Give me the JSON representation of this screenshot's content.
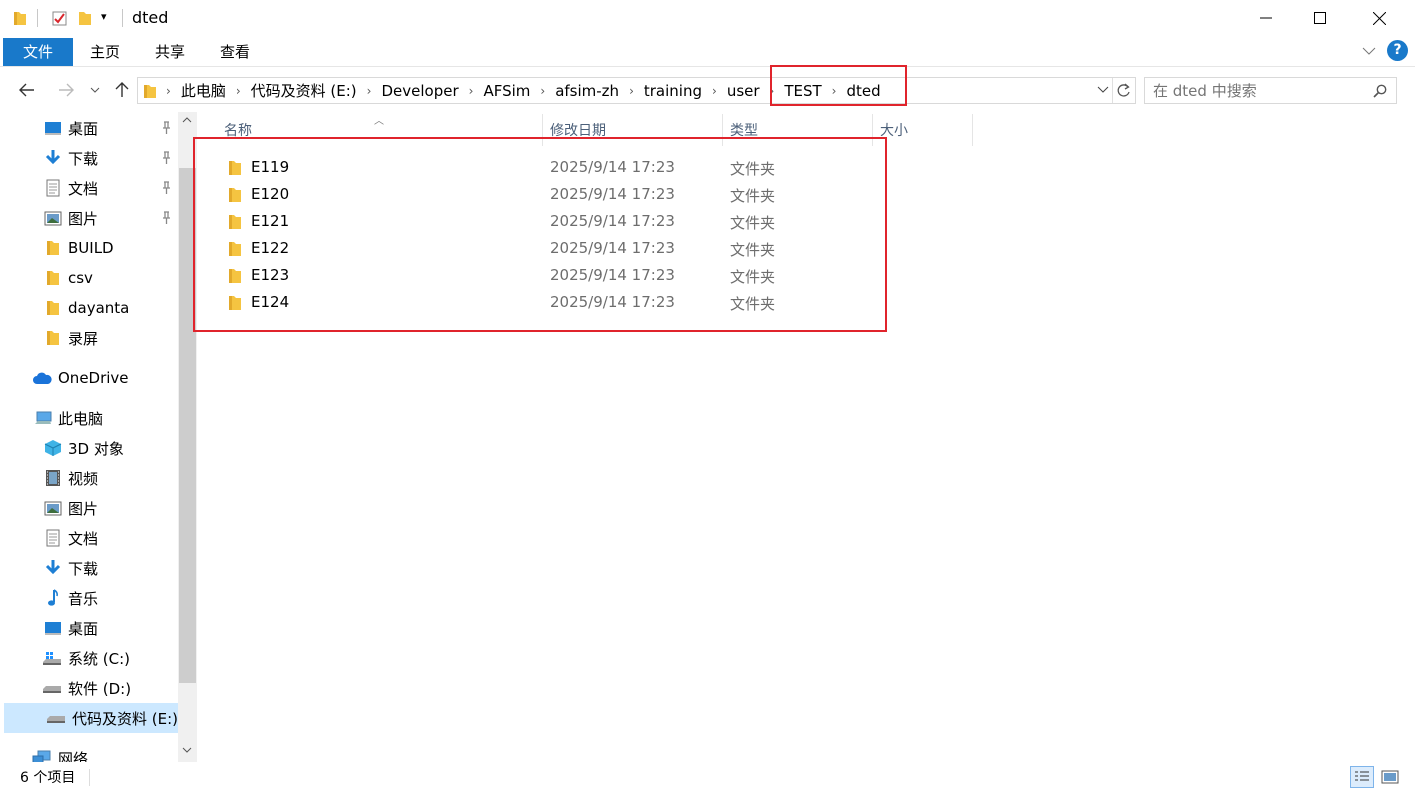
{
  "window": {
    "title": "dted",
    "minimize_glyph": "─",
    "maximize_glyph": "☐",
    "close_glyph": "✕"
  },
  "ribbon": {
    "tabs": [
      "文件",
      "主页",
      "共享",
      "查看"
    ],
    "help_glyph": "?",
    "expand_glyph": "﹀"
  },
  "address": {
    "crumbs": [
      "此电脑",
      "代码及资料 (E:)",
      "Developer",
      "AFSim",
      "afsim-zh",
      "training",
      "user",
      "TEST",
      "dted"
    ],
    "search_placeholder": "在 dted 中搜索"
  },
  "nav": {
    "quick_access": [
      {
        "label": "桌面",
        "icon": "desktop-icon",
        "pinned": true
      },
      {
        "label": "下载",
        "icon": "download-icon",
        "pinned": true
      },
      {
        "label": "文档",
        "icon": "document-icon",
        "pinned": true
      },
      {
        "label": "图片",
        "icon": "picture-icon",
        "pinned": true
      },
      {
        "label": "BUILD",
        "icon": "folder-icon",
        "pinned": false
      },
      {
        "label": "csv",
        "icon": "folder-icon",
        "pinned": false
      },
      {
        "label": "dayanta",
        "icon": "folder-icon",
        "pinned": false
      },
      {
        "label": "录屏",
        "icon": "folder-icon",
        "pinned": false
      }
    ],
    "onedrive": "OneDrive",
    "this_pc": "此电脑",
    "pc_items": [
      {
        "label": "3D 对象",
        "icon": "3d-objects-icon"
      },
      {
        "label": "视频",
        "icon": "video-icon"
      },
      {
        "label": "图片",
        "icon": "picture-icon"
      },
      {
        "label": "文档",
        "icon": "document-icon"
      },
      {
        "label": "下载",
        "icon": "download-icon"
      },
      {
        "label": "音乐",
        "icon": "music-icon"
      },
      {
        "label": "桌面",
        "icon": "desktop-icon"
      },
      {
        "label": "系统 (C:)",
        "icon": "system-drive-icon"
      },
      {
        "label": "软件 (D:)",
        "icon": "drive-icon"
      },
      {
        "label": "代码及资料 (E:)",
        "icon": "drive-icon",
        "selected": true
      }
    ],
    "network": "网络"
  },
  "columns": [
    "名称",
    "修改日期",
    "类型",
    "大小"
  ],
  "files": [
    {
      "name": "E119",
      "date": "2025/9/14 17:23",
      "type": "文件夹"
    },
    {
      "name": "E120",
      "date": "2025/9/14 17:23",
      "type": "文件夹"
    },
    {
      "name": "E121",
      "date": "2025/9/14 17:23",
      "type": "文件夹"
    },
    {
      "name": "E122",
      "date": "2025/9/14 17:23",
      "type": "文件夹"
    },
    {
      "name": "E123",
      "date": "2025/9/14 17:23",
      "type": "文件夹"
    },
    {
      "name": "E124",
      "date": "2025/9/14 17:23",
      "type": "文件夹"
    }
  ],
  "status": {
    "item_count": "6 个项目"
  },
  "colors": {
    "accent": "#1979ca",
    "highlight_box": "#e0242c",
    "folder": "#f5c441",
    "selected_bg": "#cce8ff"
  }
}
